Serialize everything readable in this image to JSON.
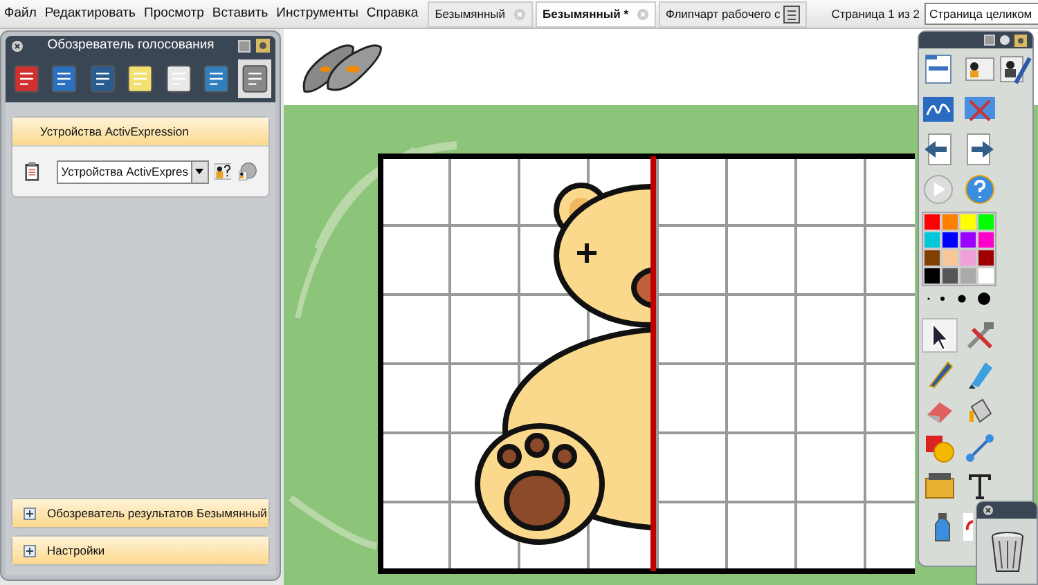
{
  "menu": [
    {
      "label": "Файл"
    },
    {
      "label": "Редактировать"
    },
    {
      "label": "Просмотр"
    },
    {
      "label": "Вставить"
    },
    {
      "label": "Инструменты"
    },
    {
      "label": "Справка"
    }
  ],
  "tabs": [
    {
      "label": "Безымянный",
      "selected": false,
      "kind": "closable"
    },
    {
      "label": "Безымянный *",
      "selected": true,
      "kind": "closable"
    },
    {
      "label": "Флипчарт рабочего с",
      "selected": false,
      "kind": "document"
    }
  ],
  "page_indicator": "Страница 1 из 2",
  "zoom_select": {
    "value": "Страница целиком"
  },
  "left_panel": {
    "title": "Обозреватель голосования",
    "sections": [
      {
        "title": "Устройства ActivExpression",
        "expanded": true,
        "device_select": {
          "value": "Устройства ActivExpres"
        }
      },
      {
        "title": "Обозреватель результатов Безымянный",
        "expanded": false
      },
      {
        "title": "Настройки",
        "expanded": false
      }
    ]
  },
  "palette": [
    {
      "color": "#ff0000"
    },
    {
      "color": "#ff8000"
    },
    {
      "color": "#ffff00"
    },
    {
      "color": "#00ff00"
    },
    {
      "color": "#00c8d8"
    },
    {
      "color": "#0000ff"
    },
    {
      "color": "#9900ff"
    },
    {
      "color": "#ff00cc"
    },
    {
      "color": "#804000"
    },
    {
      "color": "#f8c898"
    },
    {
      "color": "#f0a0d8"
    },
    {
      "color": "#a00000"
    },
    {
      "color": "#000000"
    },
    {
      "color": "#555555"
    },
    {
      "color": "#aaaaaa"
    },
    {
      "color": "#ffffff"
    }
  ],
  "tools": [
    {
      "kind": "pointer",
      "selected": true
    },
    {
      "kind": "tools",
      "selected": false
    },
    {
      "kind": "pen",
      "selected": false
    },
    {
      "kind": "highlighter",
      "selected": false
    },
    {
      "kind": "eraser",
      "selected": false
    },
    {
      "kind": "fill",
      "selected": false
    },
    {
      "kind": "shape",
      "selected": false
    },
    {
      "kind": "connector",
      "selected": false
    },
    {
      "kind": "clipart",
      "selected": false
    },
    {
      "kind": "text",
      "selected": false
    }
  ]
}
